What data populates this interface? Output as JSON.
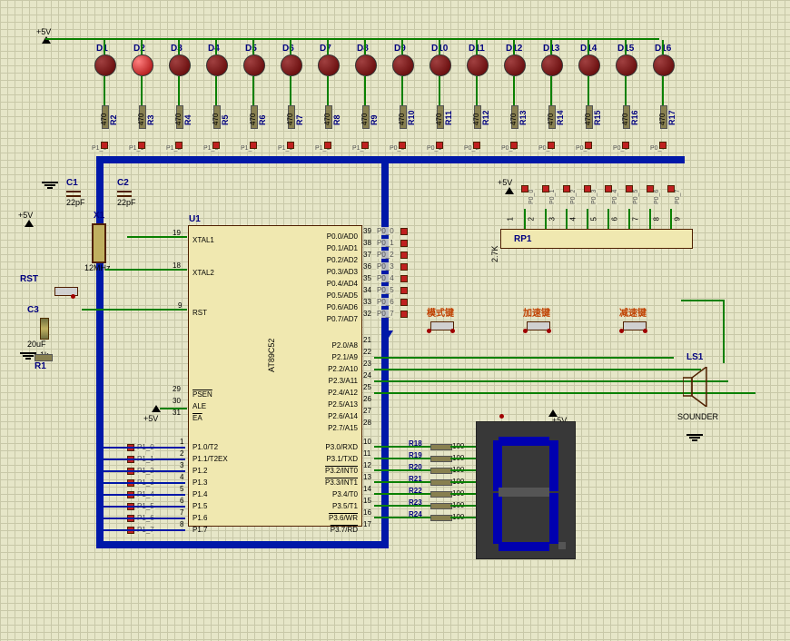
{
  "power": {
    "vcc": "+5V"
  },
  "leds": [
    {
      "ref": "D1"
    },
    {
      "ref": "D2"
    },
    {
      "ref": "D3"
    },
    {
      "ref": "D4"
    },
    {
      "ref": "D5"
    },
    {
      "ref": "D6"
    },
    {
      "ref": "D7"
    },
    {
      "ref": "D8"
    },
    {
      "ref": "D9"
    },
    {
      "ref": "D10"
    },
    {
      "ref": "D11"
    },
    {
      "ref": "D12"
    },
    {
      "ref": "D13"
    },
    {
      "ref": "D14"
    },
    {
      "ref": "D15"
    },
    {
      "ref": "D16"
    }
  ],
  "led_resistors": [
    {
      "ref": "R2",
      "val": "470",
      "net": "P1_0"
    },
    {
      "ref": "R3",
      "val": "470",
      "net": "P1_1"
    },
    {
      "ref": "R4",
      "val": "470",
      "net": "P1_2"
    },
    {
      "ref": "R5",
      "val": "470",
      "net": "P1_3"
    },
    {
      "ref": "R6",
      "val": "470",
      "net": "P1_4"
    },
    {
      "ref": "R7",
      "val": "470",
      "net": "P1_5"
    },
    {
      "ref": "R8",
      "val": "470",
      "net": "P1_6"
    },
    {
      "ref": "R9",
      "val": "470",
      "net": "P1_7"
    },
    {
      "ref": "R10",
      "val": "470",
      "net": "P0_0"
    },
    {
      "ref": "R11",
      "val": "470",
      "net": "P0_1"
    },
    {
      "ref": "R12",
      "val": "470",
      "net": "P0_2"
    },
    {
      "ref": "R13",
      "val": "470",
      "net": "P0_3"
    },
    {
      "ref": "R14",
      "val": "470",
      "net": "P0_4"
    },
    {
      "ref": "R15",
      "val": "470",
      "net": "P0_5"
    },
    {
      "ref": "R16",
      "val": "470",
      "net": "P0_6"
    },
    {
      "ref": "R17",
      "val": "470",
      "net": "P0_7"
    }
  ],
  "caps": {
    "C1": {
      "ref": "C1",
      "val": "22pF"
    },
    "C2": {
      "ref": "C2",
      "val": "22pF"
    },
    "C3": {
      "ref": "C3",
      "val": "20uF"
    }
  },
  "xtal": {
    "ref": "X1",
    "val": "12MHz"
  },
  "reset": {
    "label": "RST",
    "R1": {
      "ref": "R1",
      "val": "1k"
    }
  },
  "mcu": {
    "ref": "U1",
    "part": "AT89C52",
    "right_pins": [
      {
        "n": "39",
        "lbl": "P0.0/AD0",
        "net": "P0_0"
      },
      {
        "n": "38",
        "lbl": "P0.1/AD1",
        "net": "P0_1"
      },
      {
        "n": "37",
        "lbl": "P0.2/AD2",
        "net": "P0_2"
      },
      {
        "n": "36",
        "lbl": "P0.3/AD3",
        "net": "P0_3"
      },
      {
        "n": "35",
        "lbl": "P0.4/AD4",
        "net": "P0_4"
      },
      {
        "n": "34",
        "lbl": "P0.5/AD5",
        "net": "P0_5"
      },
      {
        "n": "33",
        "lbl": "P0.6/AD6",
        "net": "P0_6"
      },
      {
        "n": "32",
        "lbl": "P0.7/AD7",
        "net": "P0_7"
      }
    ],
    "right_pins2": [
      {
        "n": "21",
        "lbl": "P2.0/A8"
      },
      {
        "n": "22",
        "lbl": "P2.1/A9"
      },
      {
        "n": "23",
        "lbl": "P2.2/A10"
      },
      {
        "n": "24",
        "lbl": "P2.3/A11"
      },
      {
        "n": "25",
        "lbl": "P2.4/A12"
      },
      {
        "n": "26",
        "lbl": "P2.5/A13"
      },
      {
        "n": "27",
        "lbl": "P2.6/A14"
      },
      {
        "n": "28",
        "lbl": "P2.7/A15"
      }
    ],
    "right_pins3": [
      {
        "n": "10",
        "lbl": "P3.0/RXD"
      },
      {
        "n": "11",
        "lbl": "P3.1/TXD"
      },
      {
        "n": "12",
        "lbl": "P3.2/INT0"
      },
      {
        "n": "13",
        "lbl": "P3.3/INT1"
      },
      {
        "n": "14",
        "lbl": "P3.4/T0"
      },
      {
        "n": "15",
        "lbl": "P3.5/T1"
      },
      {
        "n": "16",
        "lbl": "P3.6/WR"
      },
      {
        "n": "17",
        "lbl": "P3.7/RD"
      }
    ],
    "left_control": [
      {
        "n": "29",
        "lbl": "PSEN"
      },
      {
        "n": "30",
        "lbl": "ALE"
      },
      {
        "n": "31",
        "lbl": "EA"
      }
    ],
    "left_p1": [
      {
        "n": "1",
        "lbl": "P1.0/T2",
        "net": "P1_0"
      },
      {
        "n": "2",
        "lbl": "P1.1/T2EX",
        "net": "P1_1"
      },
      {
        "n": "3",
        "lbl": "P1.2",
        "net": "P1_2"
      },
      {
        "n": "4",
        "lbl": "P1.3",
        "net": "P1_3"
      },
      {
        "n": "5",
        "lbl": "P1.4",
        "net": "P1_4"
      },
      {
        "n": "6",
        "lbl": "P1.5",
        "net": "P1_5"
      },
      {
        "n": "7",
        "lbl": "P1.6",
        "net": "P1_6"
      },
      {
        "n": "8",
        "lbl": "P1.7",
        "net": "P1_7"
      }
    ],
    "xtal_pins": {
      "p19": "19",
      "p18": "18",
      "xtal1": "XTAL1",
      "xtal2": "XTAL2"
    },
    "rst_pin": {
      "n": "9",
      "lbl": "RST"
    }
  },
  "rp1": {
    "ref": "RP1",
    "val": "2.7K",
    "nets": [
      "P0_0",
      "P0_1",
      "P0_2",
      "P0_3",
      "P0_4",
      "P0_5",
      "P0_6",
      "P0_7"
    ],
    "pins": [
      "1",
      "2",
      "3",
      "4",
      "5",
      "6",
      "7",
      "8",
      "9"
    ]
  },
  "buttons": {
    "mode": {
      "label": "模式键"
    },
    "up": {
      "label": "加速键"
    },
    "down": {
      "label": "减速键"
    }
  },
  "disp_res": [
    {
      "ref": "R18",
      "val": "100"
    },
    {
      "ref": "R19",
      "val": "100"
    },
    {
      "ref": "R20",
      "val": "100"
    },
    {
      "ref": "R21",
      "val": "100"
    },
    {
      "ref": "R22",
      "val": "100"
    },
    {
      "ref": "R23",
      "val": "100"
    },
    {
      "ref": "R24",
      "val": "100"
    }
  ],
  "sounder": {
    "ref": "LS1",
    "label": "SOUNDER"
  },
  "digit": "0"
}
